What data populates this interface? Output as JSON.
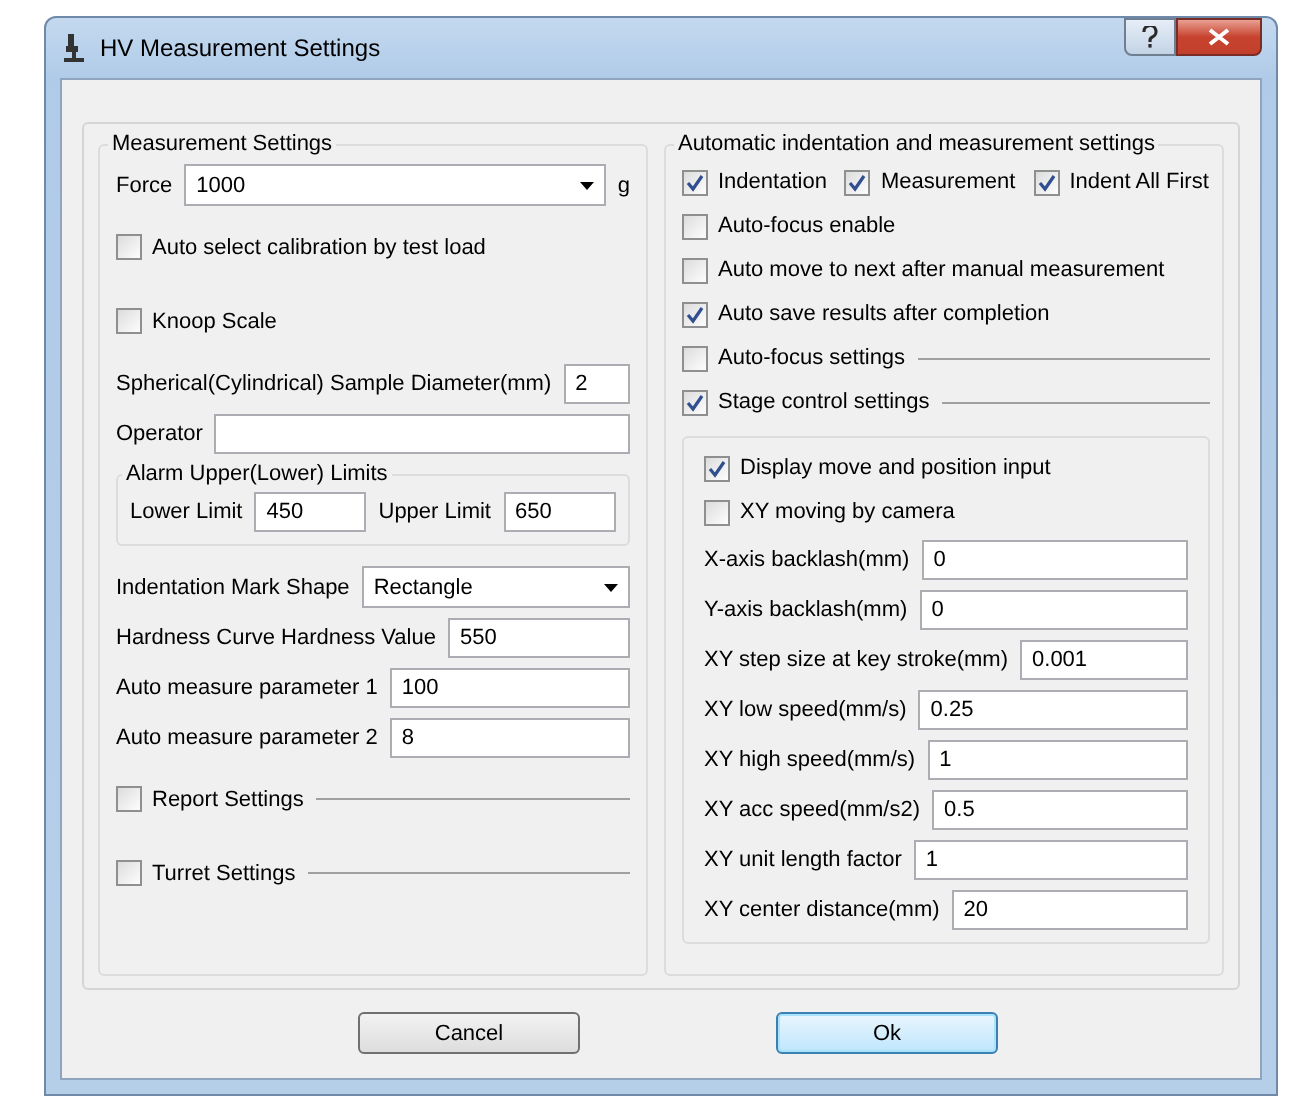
{
  "window": {
    "title": "HV Measurement Settings"
  },
  "left_group": {
    "title": "Measurement Settings",
    "rows": [
      {
        "kind": "combo",
        "label": "Force",
        "value": "1000",
        "unit": "g"
      },
      {
        "kind": "checkbox",
        "label": "Auto select calibration by test load",
        "checked": false
      },
      {
        "kind": "checkbox",
        "label": "Knoop Scale",
        "checked": false
      },
      {
        "kind": "field",
        "label": "Spherical(Cylindrical) Sample Diameter(mm)",
        "value": "2"
      },
      {
        "kind": "field",
        "label": "Operator"
      },
      {
        "kind": "limits",
        "title": "Alarm Upper(Lower) Limits",
        "fields": [
          {
            "label": "Lower Limit",
            "value": "450"
          },
          {
            "label": "Upper Limit",
            "value": "650"
          }
        ]
      },
      {
        "kind": "combo",
        "label": "Indentation Mark Shape",
        "value": "Rectangle"
      },
      {
        "kind": "field",
        "label": "Hardness Curve Hardness Value",
        "value": "550"
      },
      {
        "kind": "field",
        "label": "Auto measure parameter 1",
        "value": "100"
      },
      {
        "kind": "field",
        "label": "Auto measure parameter 2",
        "value": "8"
      },
      {
        "kind": "section",
        "label": "Report Settings",
        "checked": false
      },
      {
        "kind": "section",
        "label": "Turret Settings",
        "checked": false
      }
    ]
  },
  "right_group": {
    "title": "Automatic indentation and measurement settings",
    "rows": [
      {
        "kind": "checkrow",
        "items": [
          {
            "label": "Indentation",
            "checked": true
          },
          {
            "label": "Measurement",
            "checked": true
          },
          {
            "label": "Indent All First",
            "checked": true
          }
        ]
      },
      {
        "kind": "checkbox",
        "label": "Auto-focus enable",
        "checked": false
      },
      {
        "kind": "checkbox",
        "label": "Auto move to next after manual measurement",
        "checked": false
      },
      {
        "kind": "checkbox",
        "label": "Auto save results after completion",
        "checked": true
      },
      {
        "kind": "section",
        "label": "Auto-focus settings",
        "checked": false
      },
      {
        "kind": "section",
        "label": "Stage control settings",
        "checked": true
      },
      {
        "kind": "panel",
        "rows": [
          {
            "kind": "checkbox",
            "label": "Display move and position input",
            "checked": true
          },
          {
            "kind": "checkbox",
            "label": "XY moving by camera",
            "checked": false
          },
          {
            "kind": "field",
            "label": "X-axis backlash(mm)",
            "value": "0"
          },
          {
            "kind": "field",
            "label": "Y-axis backlash(mm)",
            "value": "0"
          },
          {
            "kind": "field",
            "label": "XY step size at key stroke(mm)",
            "value": "0.001"
          },
          {
            "kind": "field",
            "label": "XY low speed(mm/s)",
            "value": "0.25"
          },
          {
            "kind": "field",
            "label": "XY high speed(mm/s)",
            "value": "1"
          },
          {
            "kind": "field",
            "label": "XY acc speed(mm/s2)",
            "value": "0.5"
          },
          {
            "kind": "field",
            "label": "XY unit length factor",
            "value": "1"
          },
          {
            "kind": "field",
            "label": "XY center distance(mm)",
            "value": "20"
          }
        ]
      }
    ]
  },
  "buttons": [
    {
      "label": "Cancel",
      "focused": false
    },
    {
      "label": "Ok",
      "focused": true
    }
  ]
}
